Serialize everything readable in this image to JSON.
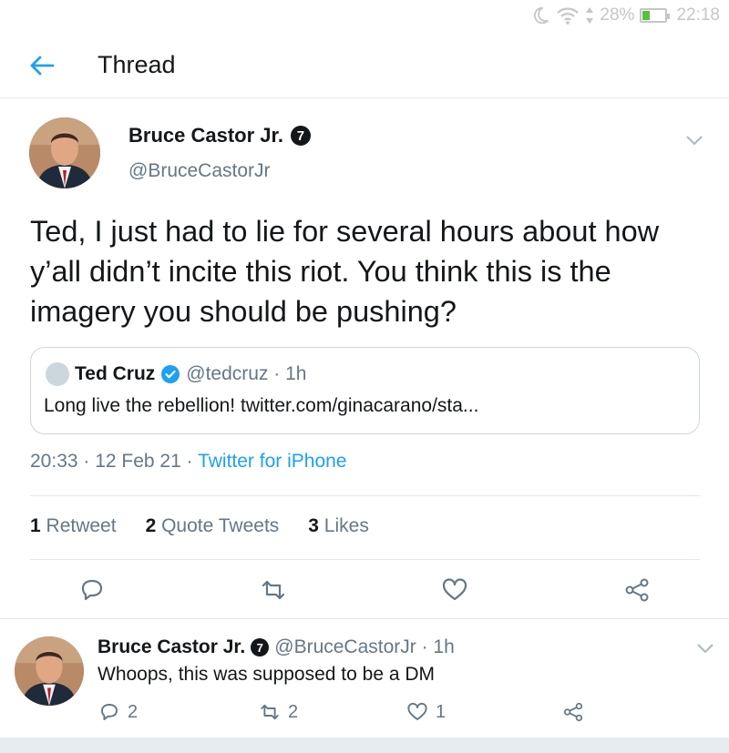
{
  "status_bar": {
    "battery": "28%",
    "battery_level": 0.28,
    "time": "22:18"
  },
  "nav": {
    "title": "Thread"
  },
  "tweet": {
    "author_name": "Bruce Castor Jr.",
    "badge": "7",
    "handle": "@BruceCastorJr",
    "text": "Ted, I just had to lie for several hours about how y’all didn’t incite this riot. You think this is the imagery you should be pushing?",
    "quote": {
      "name": "Ted Cruz",
      "meta": "@tedcruz · 1h",
      "text": "Long live the rebellion! twitter.com/ginacarano/sta..."
    },
    "timestamp": "20:33 · 12 Feb 21 · ",
    "source": "Twitter for iPhone",
    "stats": {
      "retweets_count": "1",
      "retweets_label": " Retweet",
      "quotes_count": "2",
      "quotes_label": " Quote Tweets",
      "likes_count": "3",
      "likes_label": " Likes"
    }
  },
  "reply": {
    "author_name": "Bruce Castor Jr.",
    "badge": "7",
    "meta": "@BruceCastorJr · 1h",
    "text": "Whoops, this was supposed to be a DM",
    "reply_count": "2",
    "retweet_count": "2",
    "like_count": "1"
  },
  "colors": {
    "accent": "#1da1f2",
    "secondary_text": "#657786",
    "border": "#e1e8ed"
  }
}
